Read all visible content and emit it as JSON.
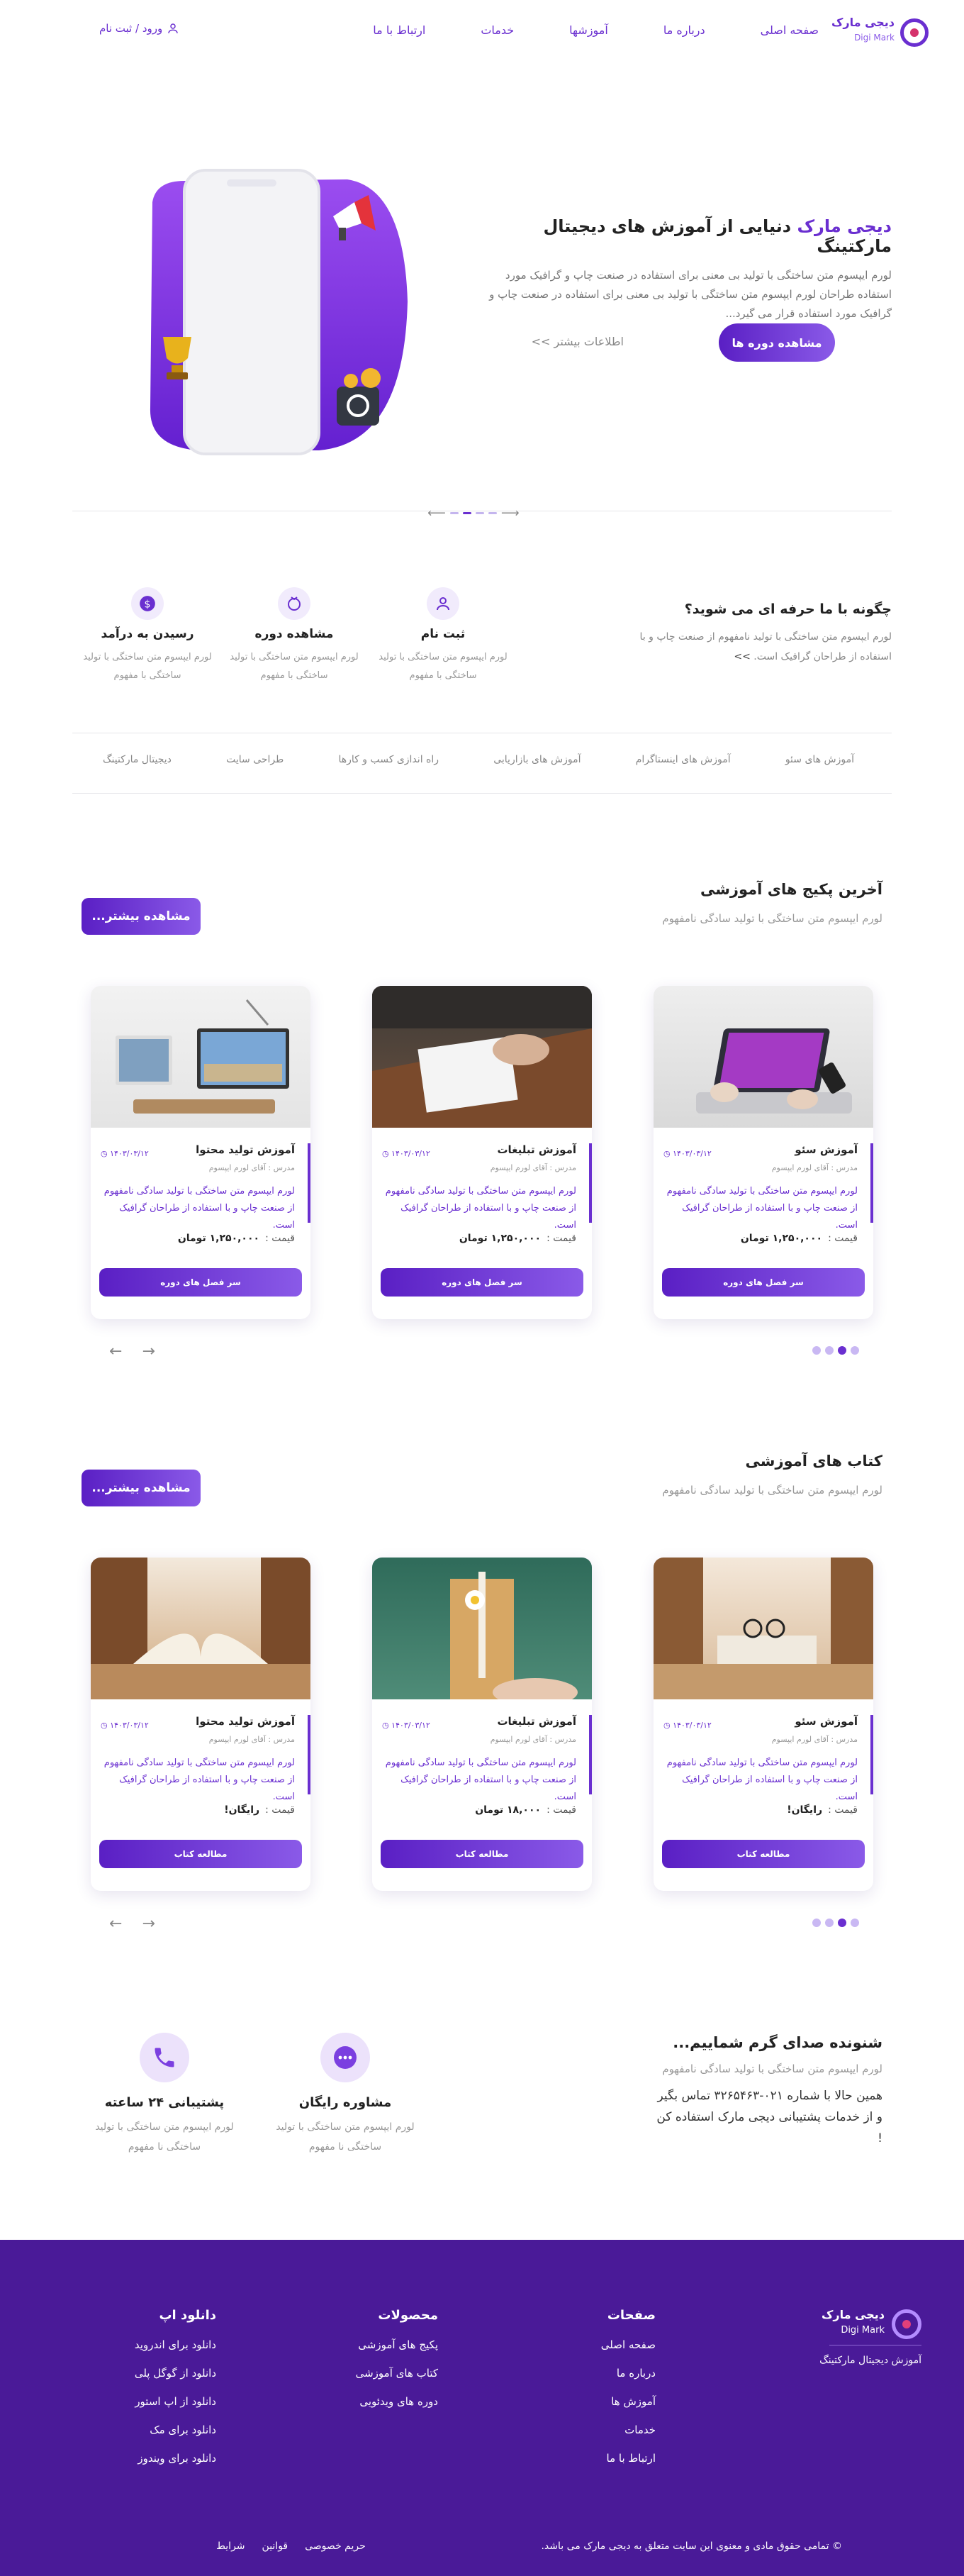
{
  "header": {
    "brand_name": "دیجی مارک",
    "brand_latin": "Digi Mark",
    "nav": [
      "صفحه اصلی",
      "درباره ما",
      "آموزشها",
      "خدمات",
      "ارتباط با ما"
    ],
    "login": "ورود / ثبت نام"
  },
  "hero": {
    "brand_word": "دیجی مارک",
    "title_rest": " دنیایی از آموزش های دیجیتال مارکتینگ",
    "text": "لورم ایپسوم متن ساختگی با تولید بی معنی برای استفاده در صنعت چاپ و گرافیک مورد استفاده طراحان لورم ایپسوم متن ساختگی با تولید بی معنی برای استفاده در صنعت چاپ و گرافیک مورد استفاده قرار می گیرد...",
    "primary_button": "مشاهده دوره ها",
    "secondary_link": "اطلاعات بیشتر >>"
  },
  "how": {
    "title": "چگونه با ما حرفه ای می شوید؟",
    "text": "لورم ایپسوم متن ساختگی با تولید نامفهوم از صنعت چاپ و با استفاده از طراحان گرافیک است.",
    "more": ">>",
    "steps": [
      {
        "icon": "user-icon",
        "title": "ثبت نام",
        "desc": "لورم ایپسوم متن ساختگی با تولید ساختگی با مفهوم"
      },
      {
        "icon": "play-icon",
        "title": "مشاهده دوره",
        "desc": "لورم ایپسوم متن ساختگی با تولید ساختگی با مفهوم"
      },
      {
        "icon": "dollar-icon",
        "title": "رسیدن به درآمد",
        "desc": "لورم ایپسوم متن ساختگی با تولید ساختگی با مفهوم"
      }
    ]
  },
  "categories": [
    "آموزش های سئو",
    "آموزش های اینستاگرام",
    "آموزش های بازاریابی",
    "راه اندازی کسب و کارها",
    "طراحی سایت",
    "دیجیتال مارکتینگ"
  ],
  "packages": {
    "title": "آخرین پکیج های آموزشی",
    "subtitle": "لورم ایپسوم متن ساختگی با تولید سادگی نامفهوم",
    "more": "مشاهده بیشتر...",
    "cards": [
      {
        "title": "آموزش سئو",
        "teacher": "مدرس : آقای لورم ایپسوم",
        "date": "۱۴۰۳/۰۳/۱۲",
        "desc": "لورم ایپسوم متن ساختگی با تولید سادگی نامفهوم از صنعت چاپ و با استفاده از طراحان گرافیک است.",
        "price_label": "قیمت :",
        "price": "۱,۲۵۰,۰۰۰ تومان",
        "button": "سر فصل های دوره"
      },
      {
        "title": "آموزش تبلیغات",
        "teacher": "مدرس : آقای لورم ایپسوم",
        "date": "۱۴۰۳/۰۳/۱۲",
        "desc": "لورم ایپسوم متن ساختگی با تولید سادگی نامفهوم از صنعت چاپ و با استفاده از طراحان گرافیک است.",
        "price_label": "قیمت :",
        "price": "۱,۲۵۰,۰۰۰ تومان",
        "button": "سر فصل های دوره"
      },
      {
        "title": "آموزش تولید محتوا",
        "teacher": "مدرس : آقای لورم ایپسوم",
        "date": "۱۴۰۳/۰۳/۱۲",
        "desc": "لورم ایپسوم متن ساختگی با تولید سادگی نامفهوم از صنعت چاپ و با استفاده از طراحان گرافیک است.",
        "price_label": "قیمت :",
        "price": "۱,۲۵۰,۰۰۰ تومان",
        "button": "سر فصل های دوره"
      }
    ]
  },
  "books": {
    "title": "کتاب های آموزشی",
    "subtitle": "لورم ایپسوم متن ساختگی با تولید سادگی نامفهوم",
    "more": "مشاهده بیشتر...",
    "cards": [
      {
        "title": "آموزش سئو",
        "teacher": "مدرس : آقای لورم ایپسوم",
        "date": "۱۴۰۳/۰۳/۱۲",
        "desc": "لورم ایپسوم متن ساختگی با تولید سادگی نامفهوم از صنعت چاپ و با استفاده از طراحان گرافیک است.",
        "price_label": "قیمت :",
        "price": "رایگان!",
        "button": "مطالعه کتاب"
      },
      {
        "title": "آموزش تبلیغات",
        "teacher": "مدرس : آقای لورم ایپسوم",
        "date": "۱۴۰۳/۰۳/۱۲",
        "desc": "لورم ایپسوم متن ساختگی با تولید سادگی نامفهوم از صنعت چاپ و با استفاده از طراحان گرافیک است.",
        "price_label": "قیمت :",
        "price": "۱۸,۰۰۰ تومان",
        "button": "مطالعه کتاب"
      },
      {
        "title": "آموزش تولید محتوا",
        "teacher": "مدرس : آقای لورم ایپسوم",
        "date": "۱۴۰۳/۰۳/۱۲",
        "desc": "لورم ایپسوم متن ساختگی با تولید سادگی نامفهوم از صنعت چاپ و با استفاده از طراحان گرافیک است.",
        "price_label": "قیمت :",
        "price": "رایگان!",
        "button": "مطالعه کتاب"
      }
    ]
  },
  "support": {
    "title": "شنونده صدای گرم شماییم...",
    "subtitle": "لورم ایپسوم متن ساختگی با تولید سادگی نامفهوم",
    "text": "همین حالا با شماره ۰۲۱-۳۲۶۵۴۶۳ تماس بگیر و از خدمات پشتیبانی دیجی مارک استفاده کن !",
    "items": [
      {
        "icon": "chat-icon",
        "title": "مشاوره رایگان",
        "desc": "لورم ایپسوم متن ساختگی با تولید ساختگی نا مفهوم"
      },
      {
        "icon": "phone-icon",
        "title": "پشتیبانی ۲۴ ساعته",
        "desc": "لورم ایپسوم متن ساختگی با تولید ساختگی نا مفهوم"
      }
    ]
  },
  "footer": {
    "brand_name": "دیجی مارک",
    "brand_latin": "Digi Mark",
    "tagline": "آموزش دیجیتال مارکتینگ",
    "pages_title": "صفحات",
    "pages": [
      "صفحه اصلی",
      "درباره ما",
      "آموزش ها",
      "خدمات",
      "ارتباط با ما"
    ],
    "products_title": "محصولات",
    "products": [
      "پکیج های آموزشی",
      "کتاب های آموزشی",
      "دوره های ویدئویی"
    ],
    "app_title": "دانلود اپ",
    "apps": [
      "دانلود برای اندروید",
      "دانلود از گوگل پلی",
      "دانلود از اپ استور",
      "دانلود برای مک",
      "دانلود برای ویندوز"
    ],
    "copyright": "© تمامی حقوق مادی و معنوی این سایت متعلق به دیجی مارک می باشد.",
    "legal": [
      "حریم خصوصی",
      "قوانین",
      "شرایط"
    ]
  },
  "colors": {
    "accent": "#6a2fd0",
    "footer_bg": "#4a1a98"
  }
}
